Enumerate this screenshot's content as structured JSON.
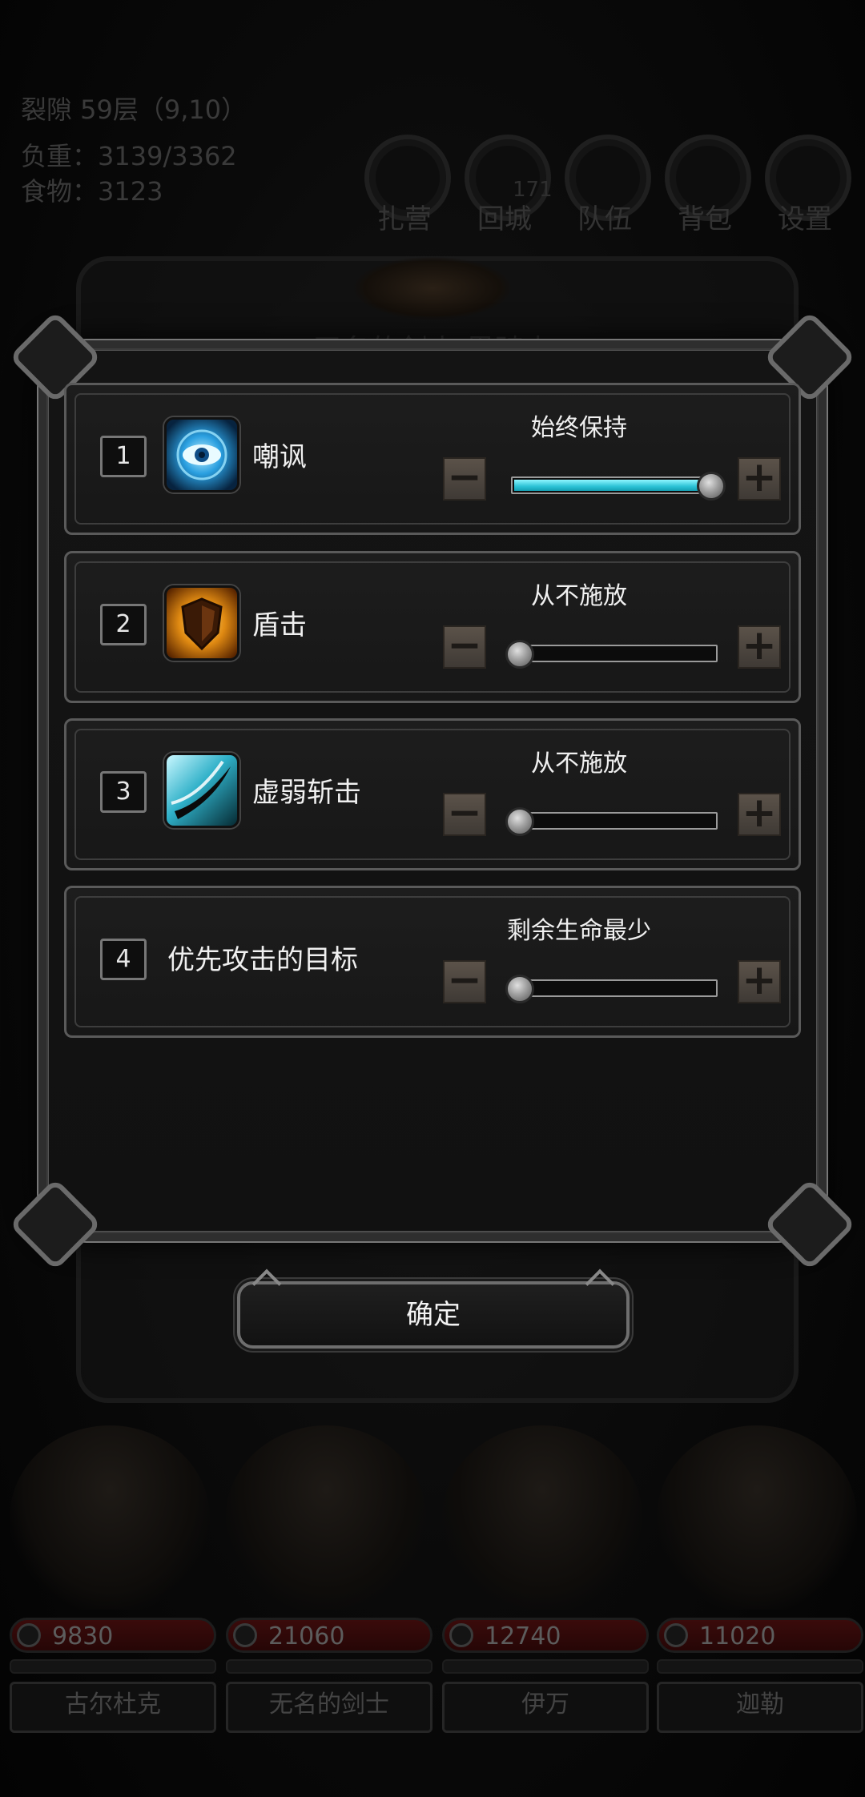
{
  "hud": {
    "floor": "裂隙 59层（9,10）",
    "load": "负重：3139/3362",
    "food": "食物：3123",
    "buttons": [
      {
        "label": "扎营",
        "icon": "camp-icon"
      },
      {
        "label": "回城",
        "icon": "return-town-icon",
        "badge": "171"
      },
      {
        "label": "队伍",
        "icon": "party-icon"
      },
      {
        "label": "背包",
        "icon": "backpack-icon"
      },
      {
        "label": "设置",
        "icon": "settings-icon"
      }
    ]
  },
  "back_panel": {
    "title": "无名的剑士 黑骑士"
  },
  "dialog": {
    "rows": [
      {
        "index": "1",
        "name": "嘲讽",
        "icon": "taunt-eye-icon",
        "mode": "始终保持",
        "level": 1.0
      },
      {
        "index": "2",
        "name": "盾击",
        "icon": "shield-bash-icon",
        "mode": "从不施放",
        "level": 0.0
      },
      {
        "index": "3",
        "name": "虚弱斩击",
        "icon": "weakening-slash-icon",
        "mode": "从不施放",
        "level": 0.0
      },
      {
        "index": "4",
        "name": "优先攻击的目标",
        "mode": "剩余生命最少",
        "level": 0.0
      }
    ],
    "minus_symbol": "−",
    "plus_symbol": "+",
    "confirm_label": "确定"
  },
  "party": [
    {
      "name": "古尔杜克",
      "hp": "9830"
    },
    {
      "name": "无名的剑士",
      "hp": "21060"
    },
    {
      "name": "伊万",
      "hp": "12740"
    },
    {
      "name": "迦勒",
      "hp": "11020"
    }
  ],
  "colors": {
    "slider_fill": "#2cc3d6",
    "step_button": "#5b5249",
    "hp_bar": "#3a0b0b"
  }
}
